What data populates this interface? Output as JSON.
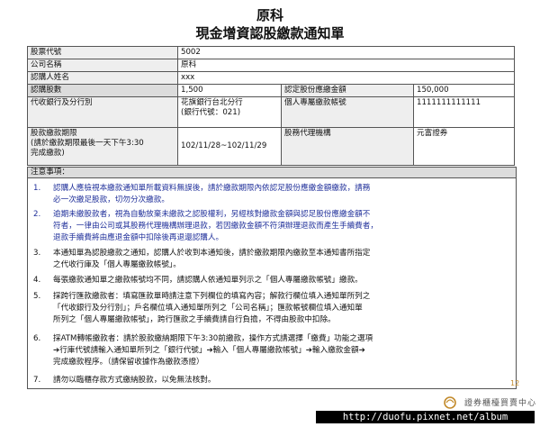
{
  "header": {
    "line1": "原科",
    "line2": "現金增資認股繳款通知單"
  },
  "table": {
    "r1": {
      "label": "股票代號",
      "value": "5002"
    },
    "r2": {
      "label": "公司名稱",
      "value": "原科"
    },
    "r3": {
      "label": "認購人姓名",
      "value": "xxx"
    },
    "r4": {
      "label": "認購股數",
      "value": "1,500",
      "label2": "認定股份應繳金額",
      "value2": "150,000"
    },
    "r5": {
      "label": "代收銀行及分行別",
      "value_a": "花旗銀行台北分行",
      "value_b": "(銀行代號：021)",
      "label2": "個人專屬繳款帳號",
      "value2": "1111111111111"
    },
    "r6": {
      "label_a": "股款繳款期限",
      "label_b": "(請於繳款期限最後一天下午3:30",
      "label_c": "完成繳款)",
      "value": "102/11/28~102/11/29",
      "label2": "股務代理機構",
      "value2": "元富證券"
    }
  },
  "notes": {
    "heading": "注意事項：",
    "items": [
      {
        "num": "1.",
        "l1": "認購人應檢視本繳款通知單所載資料無誤後，請於繳款期限內依認足股份應繳金額繳款，請務",
        "l2": "必一次繳足股款，切勿分次繳款。",
        "l3": ""
      },
      {
        "num": "2.",
        "l1": "逾期未繳股款者，視為自動放棄未繳款之認股權利，另經核對繳款金額與認足股份應繳金額不",
        "l2": "符者，一律由公司或其股務代理機構辦理退款，若因繳款金額不符須辦理退款而產生手續費者，",
        "l3": "退款手續費將由應退金額中扣除後再退還認購人。"
      },
      {
        "num": "3.",
        "l1": "本通知單為認股繳款之通知，認購人於收到本通知後，請於繳款期限內繳款至本通知書所指定",
        "l2": "之代收行庫及「個人專屬繳款帳號」。",
        "l3": ""
      },
      {
        "num": "4.",
        "l1": "每張繳款通知單之繳款帳號均不同，請認購人依通知單列示之「個人專屬繳款帳號」繳款。",
        "l2": "",
        "l3": ""
      },
      {
        "num": "5.",
        "l1": "採跨行匯款繳款者：填寫匯款單時請注意下列欄位的填寫內容；解款行欄位填入通知單所列之",
        "l2": "「代收銀行及分行別」；戶名欄位填入通知單所列之「公司名稱」；匯款帳號欄位填入通知單",
        "l3": "所列之「個人專屬繳款帳號」，跨行匯款之手續費請自行負擔，不得由股款中扣除。"
      },
      {
        "num": "6.",
        "l1": "採ATM轉帳繳款者：請於股款繳納期限下午3:30前繳款，操作方式請選擇「繳費」功能之選項",
        "l2": "➔行庫代號請輸入通知單所列之「銀行代號」➔輸入「個人專屬繳款帳號」➔輸入繳款金額➔",
        "l3": "完成繳款程序。（請保留收據作為繳款憑證）"
      },
      {
        "num": "7.",
        "l1": "請勿以臨櫃存款方式繳納股款，以免無法核對。",
        "l2": "",
        "l3": ""
      }
    ]
  },
  "footer": {
    "page_number": "12",
    "logo_text": "證券櫃檯買賣中心",
    "url": "http://duofu.pixnet.net/album"
  },
  "colors": {
    "blue_text": "#1f2f9a",
    "shade": "#dcdcdc",
    "page_number": "#c28a2b"
  }
}
